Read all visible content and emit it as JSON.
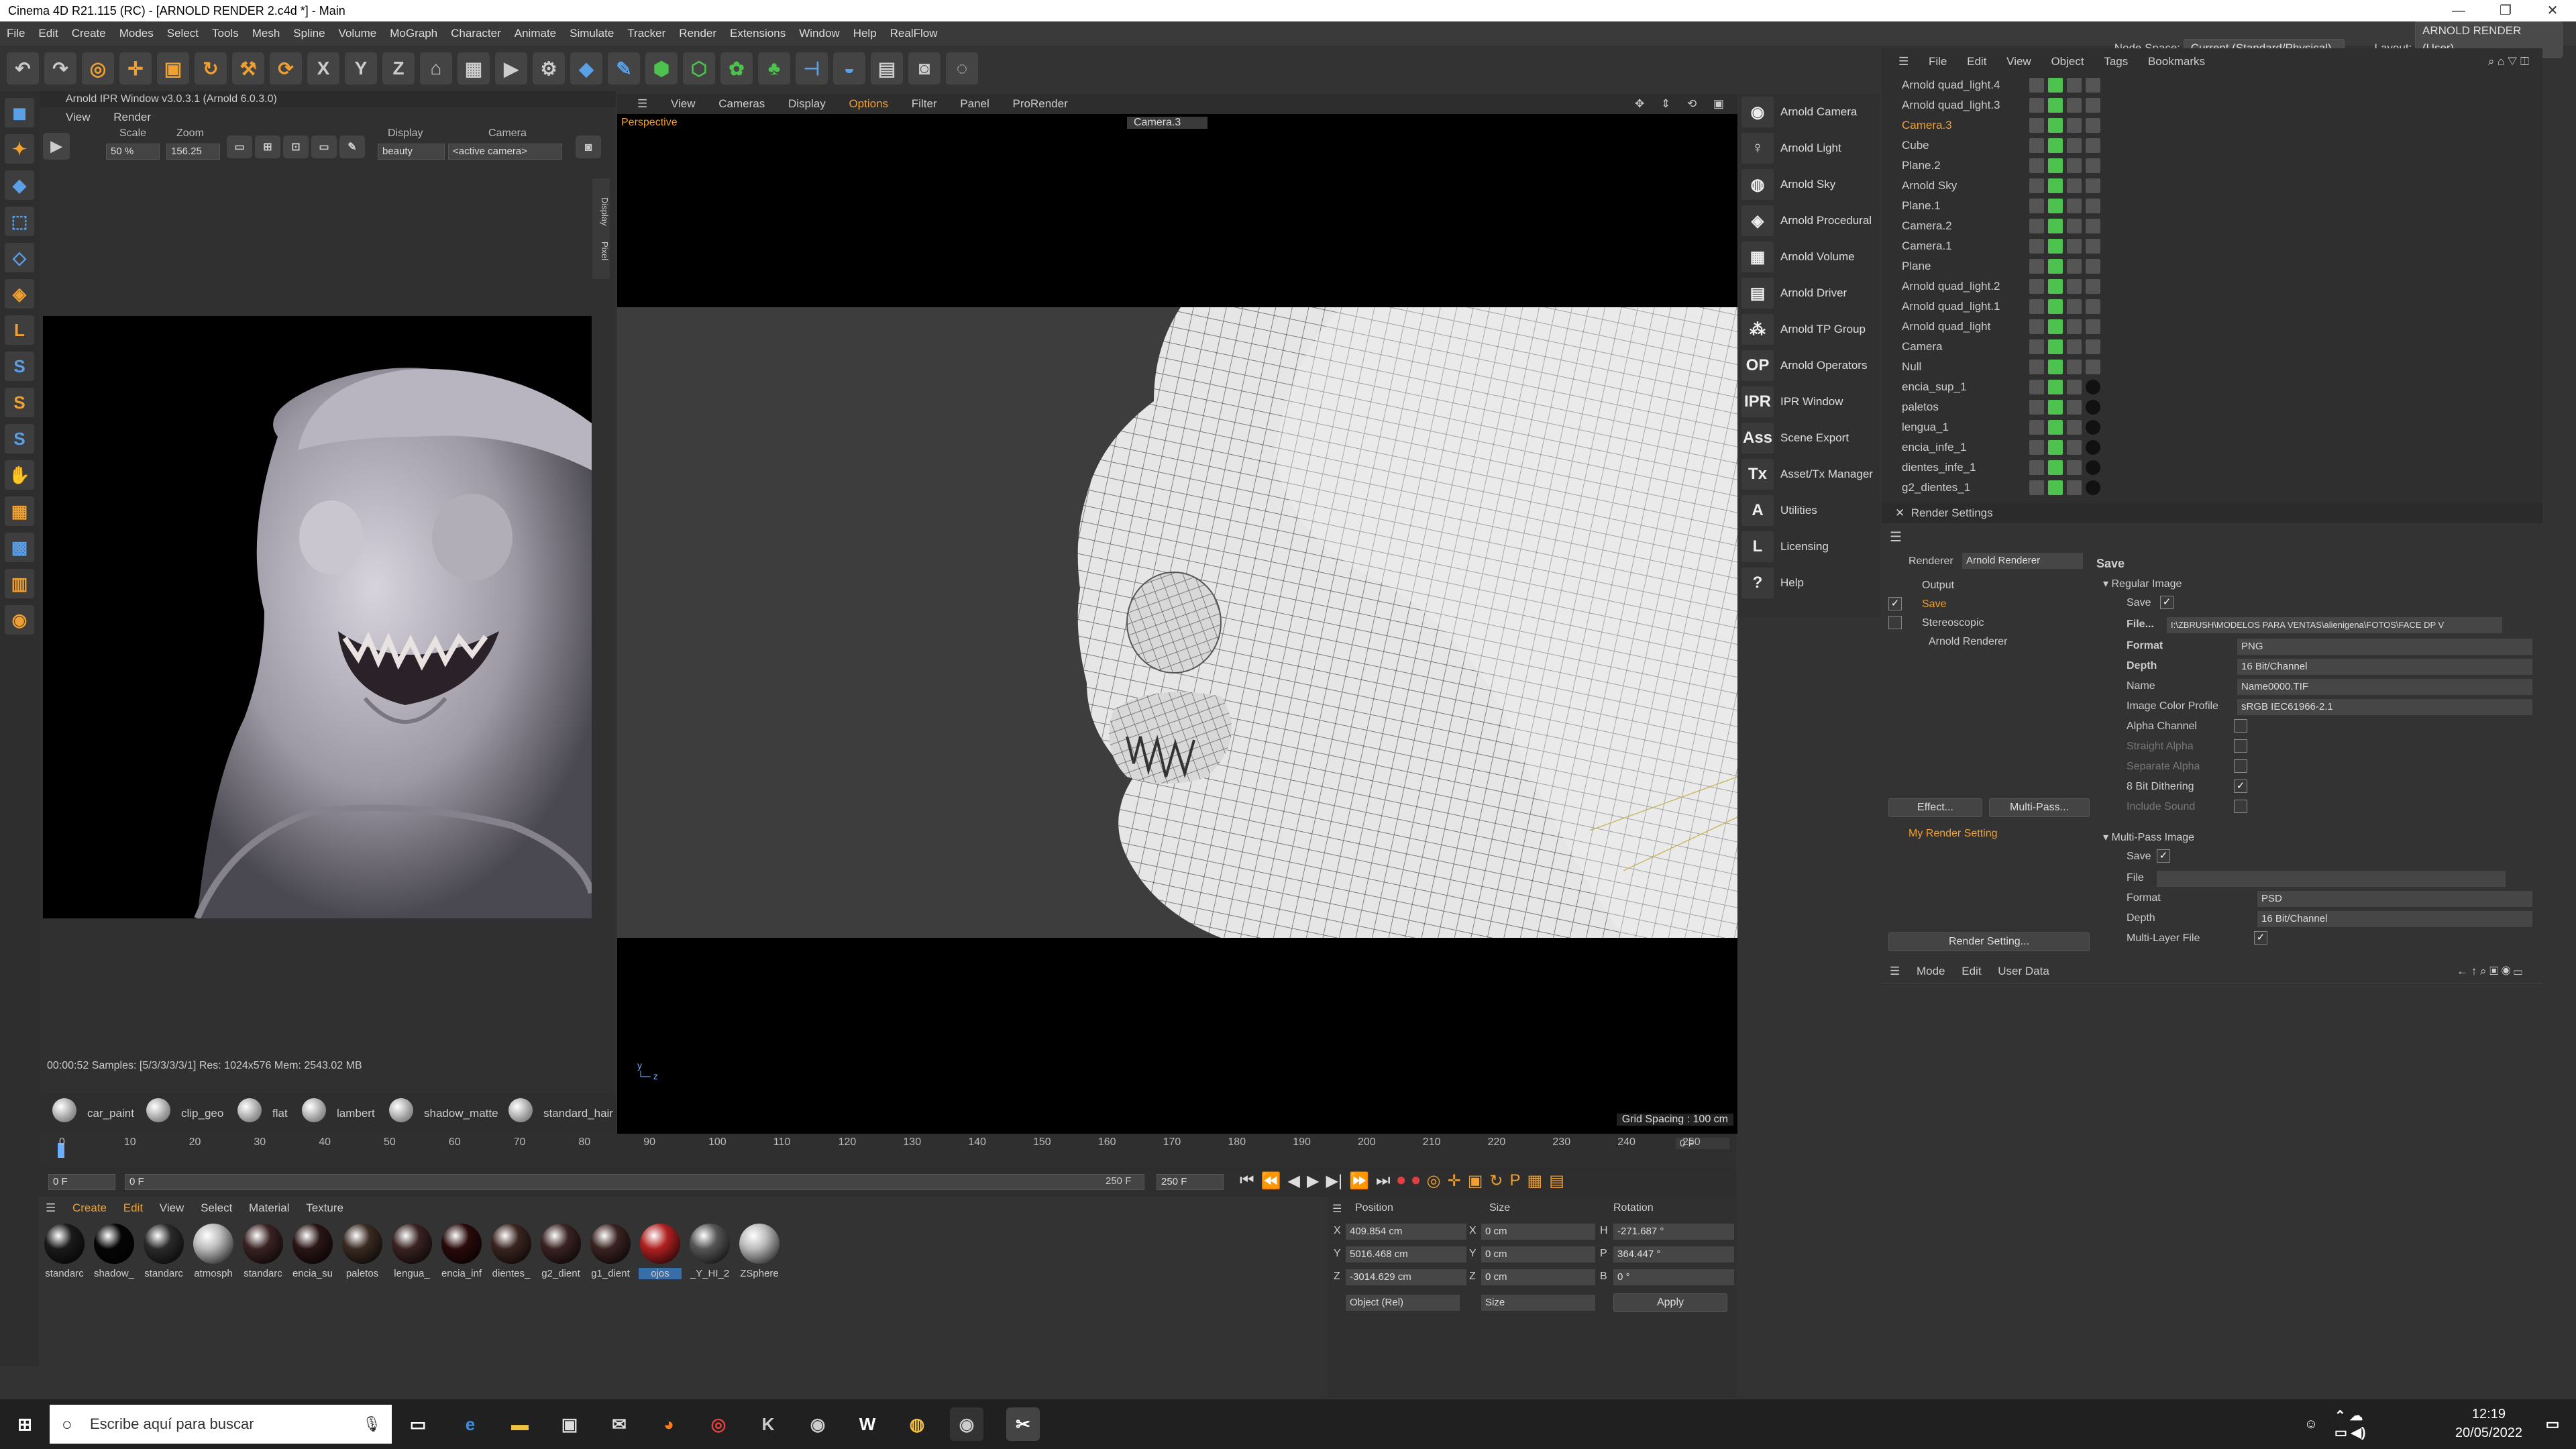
{
  "title": "Cinema 4D R21.115 (RC) - [ARNOLD RENDER 2.c4d *] - Main",
  "menu": [
    "File",
    "Edit",
    "Create",
    "Modes",
    "Select",
    "Tools",
    "Mesh",
    "Spline",
    "Volume",
    "MoGraph",
    "Character",
    "Animate",
    "Simulate",
    "Tracker",
    "Render",
    "Extensions",
    "Window",
    "Help",
    "RealFlow"
  ],
  "nodespace_label": "Node Space:",
  "nodespace_value": "Current (Standard/Physical)",
  "layout_label": "Layout:",
  "layout_value": "ARNOLD RENDER (User)",
  "ipr": {
    "title": "Arnold IPR Window v3.0.3.1 (Arnold 6.0.3.0)",
    "menu": [
      "View",
      "Render"
    ],
    "scale_label": "Scale",
    "scale_value": "50 %",
    "zoom_label": "Zoom",
    "zoom_value": "156.25",
    "display_label": "Display",
    "display_value": "beauty",
    "camera_label": "Camera",
    "camera_value": "<active camera>",
    "side_tabs": [
      "Display",
      "Pixel"
    ],
    "status": "00:00:52  Samples: [5/3/3/3/3/1]  Res: 1024x576  Mem: 2543.02 MB"
  },
  "materials_bar": [
    "car_paint",
    "clip_geo",
    "flat",
    "lambert",
    "shadow_matte",
    "standard_hair"
  ],
  "viewport": {
    "menu": [
      "View",
      "Cameras",
      "Display",
      "Options",
      "Filter",
      "Panel",
      "ProRender"
    ],
    "label": "Perspective",
    "camera": "Camera.3",
    "grid": "Grid Spacing : 100 cm"
  },
  "arnold_menu": [
    {
      "icon": "camera-icon",
      "glyph": "◉",
      "label": "Arnold Camera"
    },
    {
      "icon": "light-bulb-icon",
      "glyph": "♀",
      "label": "Arnold Light"
    },
    {
      "icon": "sky-icon",
      "glyph": "◍",
      "label": "Arnold Sky"
    },
    {
      "icon": "procedural-icon",
      "glyph": "◈",
      "label": "Arnold Procedural"
    },
    {
      "icon": "volume-icon",
      "glyph": "▦",
      "label": "Arnold Volume"
    },
    {
      "icon": "driver-icon",
      "glyph": "▤",
      "label": "Arnold Driver"
    },
    {
      "icon": "tp-group-icon",
      "glyph": "⁂",
      "label": "Arnold TP Group"
    },
    {
      "icon": "operators-icon",
      "glyph": "OP",
      "label": "Arnold Operators"
    },
    {
      "icon": "ipr-icon",
      "glyph": "IPR",
      "label": "IPR Window"
    },
    {
      "icon": "ass-icon",
      "glyph": "Ass",
      "label": "Scene Export"
    },
    {
      "icon": "tx-icon",
      "glyph": "Tx",
      "label": "Asset/Tx Manager"
    },
    {
      "icon": "utilities-icon",
      "glyph": "A",
      "label": "Utilities"
    },
    {
      "icon": "licensing-icon",
      "glyph": "L",
      "label": "Licensing"
    },
    {
      "icon": "help-icon",
      "glyph": "?",
      "label": "Help"
    }
  ],
  "object_manager": {
    "menu": [
      "File",
      "Edit",
      "View",
      "Object",
      "Tags",
      "Bookmarks"
    ],
    "objects": [
      {
        "name": "Arnold quad_light.4",
        "sel": false
      },
      {
        "name": "Arnold quad_light.3",
        "sel": false
      },
      {
        "name": "Camera.3",
        "sel": true
      },
      {
        "name": "Cube",
        "sel": false
      },
      {
        "name": "Plane.2",
        "sel": false
      },
      {
        "name": "Arnold Sky",
        "sel": false
      },
      {
        "name": "Plane.1",
        "sel": false
      },
      {
        "name": "Camera.2",
        "sel": false
      },
      {
        "name": "Camera.1",
        "sel": false
      },
      {
        "name": "Plane",
        "sel": false
      },
      {
        "name": "Arnold quad_light.2",
        "sel": false
      },
      {
        "name": "Arnold quad_light.1",
        "sel": false
      },
      {
        "name": "Arnold quad_light",
        "sel": false
      },
      {
        "name": "Camera",
        "sel": false
      },
      {
        "name": "Null",
        "sel": false
      },
      {
        "name": "encia_sup_1",
        "sel": false
      },
      {
        "name": "paletos",
        "sel": false
      },
      {
        "name": "lengua_1",
        "sel": false
      },
      {
        "name": "encia_infe_1",
        "sel": false
      },
      {
        "name": "dientes_infe_1",
        "sel": false
      },
      {
        "name": "g2_dientes_1",
        "sel": false
      }
    ]
  },
  "render_settings": {
    "title": "Render Settings",
    "renderer_label": "Renderer",
    "renderer_value": "Arnold Renderer",
    "tree": [
      "Output",
      "Save",
      "Stereoscopic",
      "Arnold Renderer"
    ],
    "effect_btn": "Effect...",
    "multipass_btn": "Multi-Pass...",
    "my_setting": "My Render Setting",
    "render_setting_btn": "Render Setting...",
    "section": "Save",
    "regular_image": "Regular Image",
    "save_label": "Save",
    "file_label": "File...",
    "file_value": "I:\\ZBRUSH\\MODELOS PARA VENTAS\\alienigena\\FOTOS\\FACE DP V",
    "format_label": "Format",
    "format_value": "PNG",
    "depth_label": "Depth",
    "depth_value": "16 Bit/Channel",
    "name_label": "Name",
    "name_value": "Name0000.TIF",
    "profile_label": "Image Color Profile",
    "profile_value": "sRGB IEC61966-2.1",
    "alpha_label": "Alpha Channel",
    "straight_label": "Straight Alpha",
    "separate_label": "Separate Alpha",
    "dither_label": "8 Bit Dithering",
    "sound_label": "Include Sound",
    "multipass_image": "Multi-Pass Image",
    "mp_save": "Save",
    "mp_file": "File",
    "mp_format_label": "Format",
    "mp_format_value": "PSD",
    "mp_depth_label": "Depth",
    "mp_depth_value": "16 Bit/Channel",
    "mp_layer_label": "Multi-Layer File"
  },
  "attributes": {
    "menu": [
      "Mode",
      "Edit",
      "User Data"
    ]
  },
  "timeline": {
    "ticks": [
      "0",
      "10",
      "20",
      "30",
      "40",
      "50",
      "60",
      "70",
      "80",
      "90",
      "100",
      "110",
      "120",
      "130",
      "140",
      "150",
      "160",
      "170",
      "180",
      "190",
      "200",
      "210",
      "220",
      "230",
      "240",
      "250"
    ],
    "frame_end": "0 F",
    "start": "0 F",
    "current": "0 F",
    "end": "250 F",
    "end2": "250 F"
  },
  "material_manager": {
    "menu": [
      "Create",
      "Edit",
      "View",
      "Select",
      "Material",
      "Texture"
    ],
    "materials": [
      {
        "name": "standarc",
        "color": "#1a1a1a"
      },
      {
        "name": "shadow_",
        "color": "#050505"
      },
      {
        "name": "standarc",
        "color": "#2a2a2a"
      },
      {
        "name": "atmosph",
        "color": "#bbbbbb"
      },
      {
        "name": "standarc",
        "color": "#3a2222"
      },
      {
        "name": "encia_su",
        "color": "#2a1515"
      },
      {
        "name": "paletos",
        "color": "#3a2a22"
      },
      {
        "name": "lengua_",
        "color": "#3a2222"
      },
      {
        "name": "encia_inf",
        "color": "#2a0a0a"
      },
      {
        "name": "dientes_",
        "color": "#3a2520"
      },
      {
        "name": "g2_dient",
        "color": "#3a2222"
      },
      {
        "name": "g1_dient",
        "color": "#3a2222"
      },
      {
        "name": "ojos",
        "color": "#b02020"
      },
      {
        "name": "_Y_HI_2",
        "color": "#555555"
      },
      {
        "name": "ZSphere",
        "color": "#bbbbbb"
      }
    ]
  },
  "coords": {
    "position": "Position",
    "size": "Size",
    "rotation": "Rotation",
    "x": "409.854 cm",
    "y": "5016.468 cm",
    "z": "-3014.629 cm",
    "sx": "0 cm",
    "sy": "0 cm",
    "sz": "0 cm",
    "h": "-271.687 °",
    "p": "364.447 °",
    "b": "0 °",
    "mode": "Object (Rel)",
    "size_mode": "Size",
    "apply": "Apply"
  },
  "taskbar": {
    "search": "Escribe aquí para buscar",
    "time": "12:19",
    "date": "20/05/2022"
  }
}
